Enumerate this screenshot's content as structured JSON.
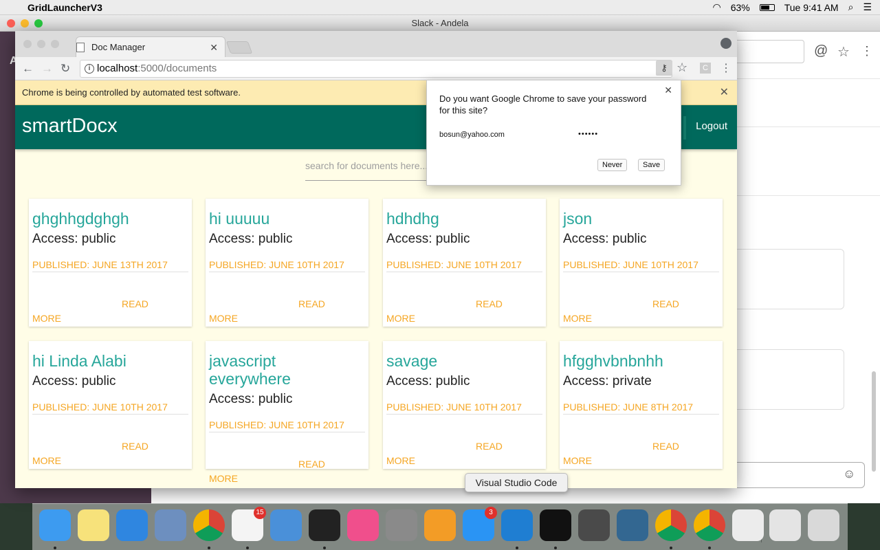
{
  "menubar": {
    "app_name": "GridLauncherV3",
    "battery": "63%",
    "clock": "Tue 9:41 AM"
  },
  "slack": {
    "window_title": "Slack - Andela",
    "sidebar_initial": "A"
  },
  "chrome": {
    "tab_title": "Doc Manager",
    "url_host": "localhost",
    "url_path": ":5000/documents",
    "ext_label": "C",
    "infobar_text": "Chrome is being controlled by automated test software."
  },
  "app": {
    "brand": "smartDocx",
    "logout_label": "Logout",
    "search_placeholder": "search for documents here..."
  },
  "documents": [
    {
      "title": "ghghhgdghgh",
      "access": "Access: public",
      "published": "PUBLISHED: JUNE 13TH 2017",
      "read": "READ",
      "more": "MORE"
    },
    {
      "title": "hi uuuuu",
      "access": "Access: public",
      "published": "PUBLISHED: JUNE 10TH 2017",
      "read": "READ",
      "more": "MORE"
    },
    {
      "title": "hdhdhg",
      "access": "Access: public",
      "published": "PUBLISHED: JUNE 10TH 2017",
      "read": "READ",
      "more": "MORE"
    },
    {
      "title": "json",
      "access": "Access: public",
      "published": "PUBLISHED: JUNE 10TH 2017",
      "read": "READ",
      "more": "MORE"
    },
    {
      "title": "hi Linda Alabi",
      "access": "Access: public",
      "published": "PUBLISHED: JUNE 10TH 2017",
      "read": "READ",
      "more": "MORE"
    },
    {
      "title": "javascript everywhere",
      "access": "Access: public",
      "published": "PUBLISHED: JUNE 10TH 2017",
      "read": "READ",
      "more": "MORE"
    },
    {
      "title": "savage",
      "access": "Access: public",
      "published": "PUBLISHED: JUNE 10TH 2017",
      "read": "READ",
      "more": "MORE"
    },
    {
      "title": "hfgghvbnbnhh",
      "access": "Access: private",
      "published": "PUBLISHED: JUNE 8TH 2017",
      "read": "READ",
      "more": "MORE"
    }
  ],
  "password_dialog": {
    "question": "Do you want Google Chrome to save your password for this site?",
    "username": "bosun@yahoo.com",
    "password_masked": "••••••",
    "never_label": "Never",
    "save_label": "Save"
  },
  "tooltip": "Visual Studio Code",
  "dock": {
    "icons": [
      "finder-icon",
      "notes-icon",
      "safari-icon",
      "preview-icon",
      "chrome-icon",
      "slack-icon",
      "keynote-icon",
      "terminal-icon",
      "itunes-icon",
      "system-preferences-icon",
      "ibooks-icon",
      "app-store-icon",
      "vscode-icon",
      "iterm-icon",
      "sublime-text-icon",
      "postgres-icon",
      "chrome-icon",
      "chrome-icon",
      "java-icon",
      "finder-window-icon",
      "trash-icon"
    ],
    "slack_badge": "15",
    "appstore_badge": "3"
  },
  "colors": {
    "appbar": "#00695c",
    "accent_title": "#26a69a",
    "accent_orange": "#f5a623",
    "page_bg": "#fffde7"
  }
}
